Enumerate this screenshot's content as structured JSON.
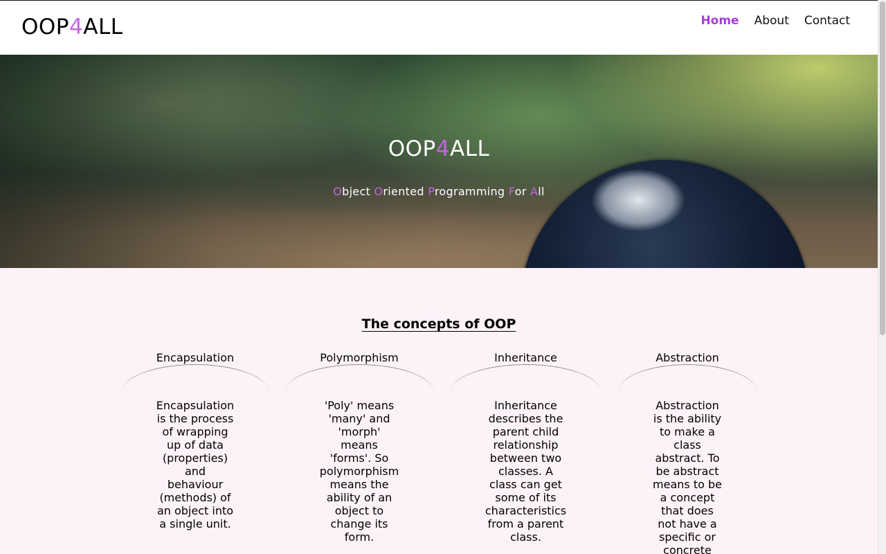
{
  "header": {
    "logo": {
      "prefix": "OOP",
      "accent": "4",
      "suffix": "ALL"
    },
    "nav": [
      {
        "label": "Home",
        "active": true
      },
      {
        "label": "About",
        "active": false
      },
      {
        "label": "Contact",
        "active": false
      }
    ]
  },
  "hero": {
    "title": {
      "prefix": "OOP",
      "accent": "4",
      "suffix": "ALL"
    },
    "subtitle": [
      {
        "accent": "O",
        "rest": "bject "
      },
      {
        "accent": "O",
        "rest": "riented "
      },
      {
        "accent": "P",
        "rest": "rogramming "
      },
      {
        "accent": "F",
        "rest": "or "
      },
      {
        "accent": "A",
        "rest": "ll"
      }
    ]
  },
  "concepts": {
    "heading": "The concepts of OOP",
    "cards": [
      {
        "title": "Encapsulation",
        "lines": [
          "Encapsulation",
          "is the process",
          "of wrapping",
          "up of data",
          "(properties)",
          "and",
          "behaviour",
          "(methods) of",
          "an object into",
          "a single unit."
        ]
      },
      {
        "title": "Polymorphism",
        "lines": [
          "'Poly' means",
          "'many' and",
          "'morph'",
          "means",
          "'forms'. So",
          "polymorphism",
          "means the",
          "ability of an",
          "object to",
          "change its",
          "form."
        ]
      },
      {
        "title": "Inheritance",
        "lines": [
          "Inheritance",
          "describes the",
          "parent child",
          "relationship",
          "between two",
          "classes. A",
          "class can get",
          "some of its",
          "characteristics",
          "from a parent",
          "class."
        ]
      },
      {
        "title": "Abstraction",
        "lines": [
          "Abstraction",
          "is the ability",
          "to make a",
          "class",
          "abstract. To",
          "be abstract",
          "means to be",
          "a concept",
          "that does",
          "not have a",
          "specific or",
          "concrete"
        ]
      }
    ]
  },
  "colors": {
    "accent": "#c465e0",
    "nav_active": "#a23fd8",
    "content_bg": "#fdf2f8",
    "header_bg": "#ffffff"
  }
}
